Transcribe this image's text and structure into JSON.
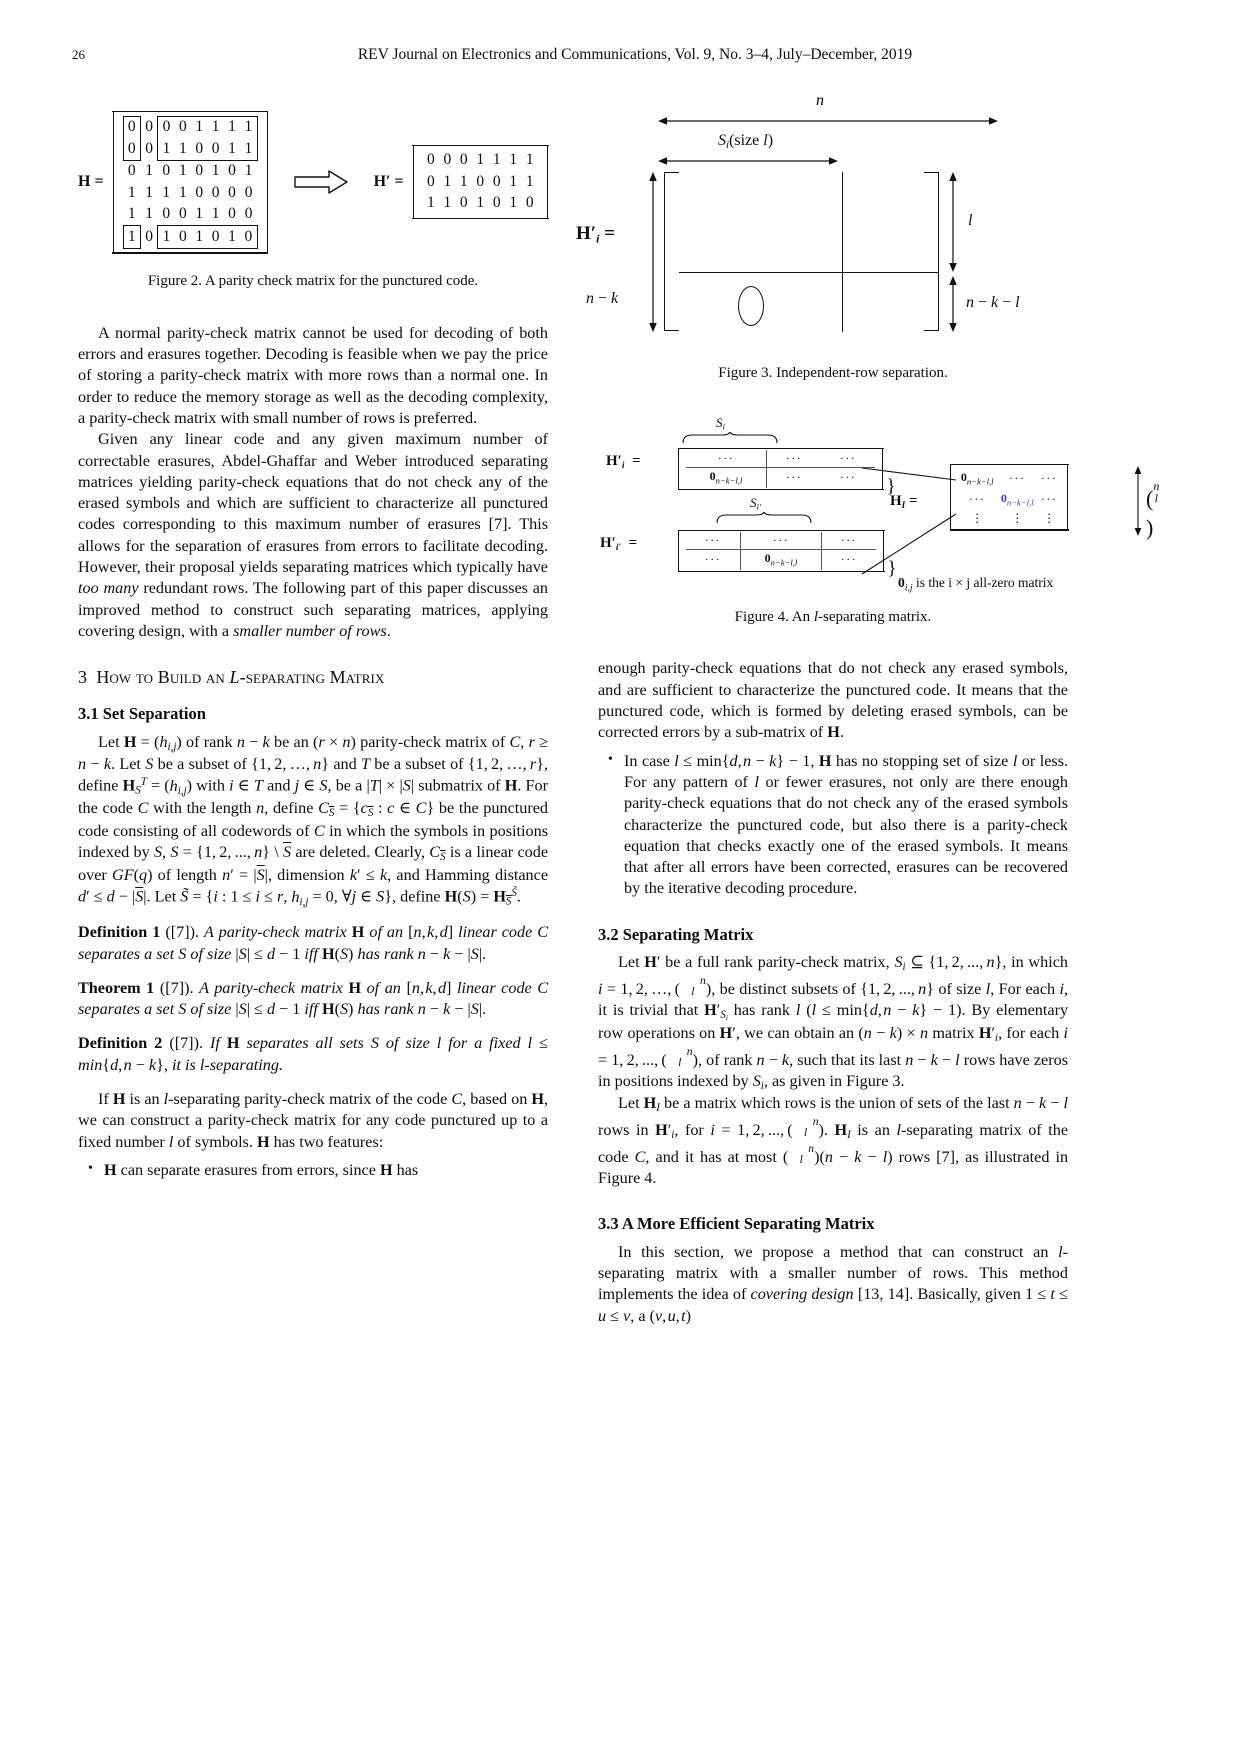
{
  "header": {
    "folio": "26",
    "journal_line": "REV Journal on Electronics and Communications, Vol. 9, No. 3–4, July–December, 2019"
  },
  "figures": {
    "fig2": {
      "caption": "Figure 2. A parity check matrix for the punctured code.",
      "H_label": "H =",
      "Hprime_label": "H′ =",
      "H_rows": [
        [
          "0",
          "0",
          "0",
          "0",
          "1",
          "1",
          "1",
          "1"
        ],
        [
          "0",
          "0",
          "1",
          "1",
          "0",
          "0",
          "1",
          "1"
        ],
        [
          "0",
          "1",
          "0",
          "1",
          "0",
          "1",
          "0",
          "1"
        ],
        [
          "1",
          "1",
          "1",
          "1",
          "0",
          "0",
          "0",
          "0"
        ],
        [
          "1",
          "1",
          "0",
          "0",
          "1",
          "1",
          "0",
          "0"
        ],
        [
          "1",
          "0",
          "1",
          "0",
          "1",
          "0",
          "1",
          "0"
        ]
      ],
      "Hprime_rows": [
        [
          "0",
          "0",
          "0",
          "1",
          "1",
          "1",
          "1"
        ],
        [
          "0",
          "1",
          "1",
          "0",
          "0",
          "1",
          "1"
        ],
        [
          "1",
          "1",
          "0",
          "1",
          "0",
          "1",
          "0"
        ]
      ],
      "arrow_icon": "double-right-arrow"
    },
    "fig3": {
      "caption": "Figure 3. Independent-row separation.",
      "label": "H′",
      "label_sub": "i",
      "label_eq": "=",
      "top_dim": "n",
      "inner_dim": "Sᵢ(size l)",
      "inner_dim_main": "S",
      "inner_dim_sub": "i",
      "inner_dim_tail": "(size l)",
      "left_dim": "n − k",
      "right_top_dim": "l",
      "right_bottom_dim": "n − k − l",
      "zero_symbol": "0"
    },
    "fig4": {
      "caption_prefix": "Figure 4. An ",
      "caption_ital": "l",
      "caption_suffix": "-separating matrix.",
      "Hi_label": "H′",
      "Hi_sub": "i",
      "Hip_label": "H′",
      "Hip_sub": "i′",
      "HI_label": "H",
      "HI_sub": "I",
      "eq": "=",
      "brace_Si": "S",
      "brace_Si_sub": "i",
      "brace_Sip": "S",
      "brace_Sip_sub": "i′",
      "zero_block": "0",
      "zero_block_sub": "n−k−l,l",
      "dots": "· · ·",
      "vdots": "⋮",
      "note": "0ᵢ,ⱼ is the i × j all-zero matrix",
      "note_prefix": "0",
      "note_sub": "i,j",
      "note_text": " is the i × j all-zero matrix",
      "binom_top": "n",
      "binom_bottom": "l",
      "blue_color": "#3b3bc8"
    }
  },
  "left_column": {
    "para1": "A normal parity-check matrix cannot be used for decoding of both errors and erasures together. Decoding is feasible when we pay the price of storing a parity-check matrix with more rows than a normal one. In order to reduce the memory storage as well as the decoding complexity, a parity-check matrix with small number of rows is preferred.",
    "para2_a": "Given any linear code and any given maximum number of correctable erasures, Abdel-Ghaffar and Weber introduced separating matrices yielding parity-check equations that do not check any of the erased symbols and which are sufficient to characterize all punctured codes corresponding to this maximum number of erasures [7]. This allows for the separation of erasures from errors to facilitate decoding. However, their proposal yields separating matrices which typically have ",
    "para2_ital1": "too many",
    "para2_b": " redundant rows. The following part of this paper discusses an improved method to construct such separating matrices, applying covering design, with a ",
    "para2_ital2": "smaller number of rows",
    "para2_c": ".",
    "section3_num": "3",
    "section3_title_a": "How to Build an ",
    "section3_title_ital": "L",
    "section3_title_b": "-separating Matrix",
    "sub31": "3.1  Set Separation",
    "def1_label": "Definition 1",
    "def1_cite": " ([7]). ",
    "thm1_label": "Theorem 1",
    "thm1_cite": " ([7]). ",
    "def2_label": "Definition 2",
    "def2_cite": " ([7]). ",
    "para_final": "If H is an l-separating parity-check matrix of the code C, based on H, we can construct a parity-check matrix for any code punctured up to a fixed number l of symbols. H has two features:",
    "bullet1": "H can separate erasures from errors, since H has"
  },
  "right_column": {
    "bullet_cont": "enough parity-check equations that do not check any erased symbols, and are sufficient to characterize the punctured code. It means that the punctured code, which is formed by deleting erased symbols, can be corrected errors by a sub-matrix of H.",
    "bullet2": "In case l ≤ min{d, n − k} − 1, H has no stopping set of size l or less. For any pattern of l or fewer erasures, not only are there enough parity-check equations that do not check any of the erased symbols characterize the punctured code, but also there is a parity-check equation that checks exactly one of the erased symbols. It means that after all errors have been corrected, erasures can be recovered by the iterative decoding procedure.",
    "sub32": "3.2  Separating Matrix",
    "sub33": "3.3  A More Efficient Separating Matrix",
    "para33_a": "In this section, we propose a method that can construct an l-separating matrix with a smaller number of rows. This method implements the idea of ",
    "para33_ital": "covering design",
    "para33_b": " [13, 14]. Basically, given 1 ≤ t ≤ u ≤ v, a (v, u, t)"
  }
}
